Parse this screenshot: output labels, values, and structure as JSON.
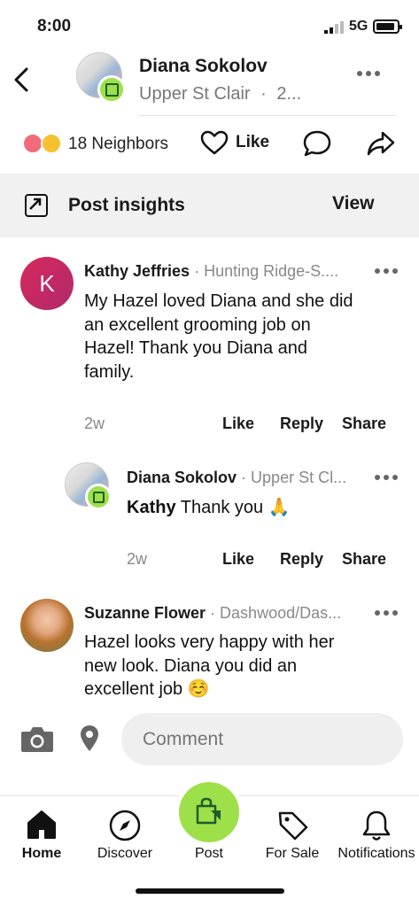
{
  "status_bar": {
    "time": "8:00",
    "network": "5G"
  },
  "header": {
    "name": "Diana Sokolov",
    "location": "Upper St Clair",
    "timestamp_truncated": "2..."
  },
  "reactions": {
    "count_label": "18 Neighbors",
    "like_label": "Like"
  },
  "insights": {
    "title": "Post insights",
    "action": "View"
  },
  "comments": [
    {
      "author": "Kathy Jeffries",
      "location": "Hunting Ridge-S....",
      "avatar_letter": "K",
      "avatar_color": "#c0265a",
      "body_lines": [
        "My Hazel loved Diana and she did",
        "an excellent grooming job on",
        "Hazel!  Thank you Diana and",
        "family."
      ],
      "age": "2w",
      "actions": {
        "like": "Like",
        "reply": "Reply",
        "share": "Share"
      },
      "replies": [
        {
          "author": "Diana Sokolov",
          "location": "Upper St Cl...",
          "mention": "Kathy",
          "text": "Thank you 🙏",
          "age": "2w",
          "actions": {
            "like": "Like",
            "reply": "Reply",
            "share": "Share"
          }
        }
      ]
    },
    {
      "author": "Suzanne Flower",
      "location": "Dashwood/Das...",
      "body_lines": [
        "Hazel looks very happy with her",
        "new look. Diana you did an",
        "excellent job ☺️"
      ]
    }
  ],
  "compose": {
    "placeholder": "Comment"
  },
  "nav": {
    "items": [
      {
        "label": "Home",
        "icon": "home-icon",
        "active": true
      },
      {
        "label": "Discover",
        "icon": "compass-icon"
      },
      {
        "label": "Post",
        "icon": "tag-bag-icon"
      },
      {
        "label": "For Sale",
        "icon": "price-tag-icon"
      },
      {
        "label": "Notifications",
        "icon": "bell-icon"
      }
    ]
  },
  "colors": {
    "accent_green": "#9ee04a",
    "muted_gray": "#888888"
  }
}
